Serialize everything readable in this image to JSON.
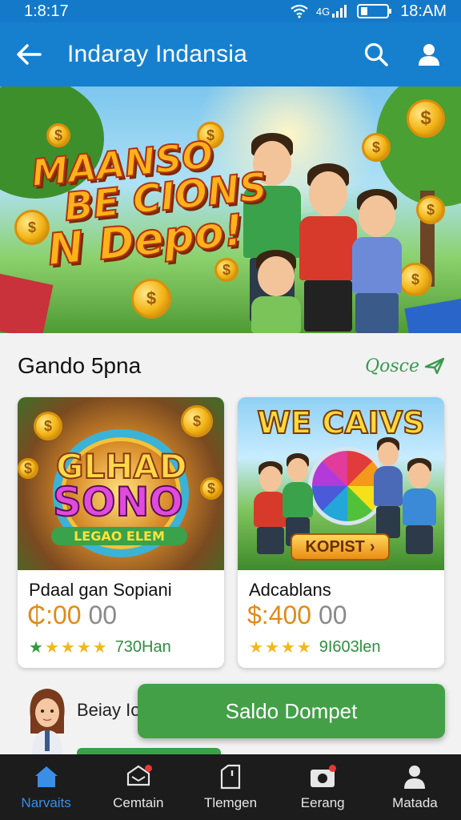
{
  "status_bar": {
    "time_left": "1:8:17",
    "time_right": "18:AM",
    "signal_text": "4G"
  },
  "header": {
    "title": "Indaray Indansia"
  },
  "banner": {
    "line1": "MAANSO",
    "line2": "BE CIONS",
    "line3": "N Depo!"
  },
  "section": {
    "title": "Gando 5pna",
    "see_all": "Qosce"
  },
  "cards": [
    {
      "art_line1": "GLHAD",
      "art_line2": "SONO",
      "art_line3": "LEGAO ELEM",
      "name": "Pdaal gan Sopiani",
      "price_main": "₵:00",
      "price_dec": "00",
      "rating_count": "730Han",
      "stars": [
        "green",
        "gold",
        "gold",
        "gold",
        "gold"
      ]
    },
    {
      "art_line1": "WE CAIVS",
      "art_button": "KOPIST",
      "name": "Adcablans",
      "price_main": "$:400",
      "price_dec": "00",
      "rating_count": "9I603len",
      "stars": [
        "gold",
        "gold",
        "gold",
        "gold",
        "gold"
      ]
    }
  ],
  "partial_row": {
    "text": "Beiay Io"
  },
  "cta": {
    "label": "Saldo Dompet"
  },
  "bottom_nav": [
    {
      "label": "Narvaits",
      "icon": "home-icon",
      "active": true
    },
    {
      "label": "Cemtain",
      "icon": "chat-icon",
      "active": false
    },
    {
      "label": "Tlemgen",
      "icon": "document-icon",
      "active": false
    },
    {
      "label": "Eerang",
      "icon": "camera-icon",
      "active": false
    },
    {
      "label": "Matada",
      "icon": "person-icon",
      "active": false
    }
  ],
  "colors": {
    "primary": "#1680cf",
    "accent_green": "#43a047",
    "price_orange": "#e08a1a",
    "nav_bg": "#1c1c1c",
    "nav_active": "#3a8ee6"
  }
}
